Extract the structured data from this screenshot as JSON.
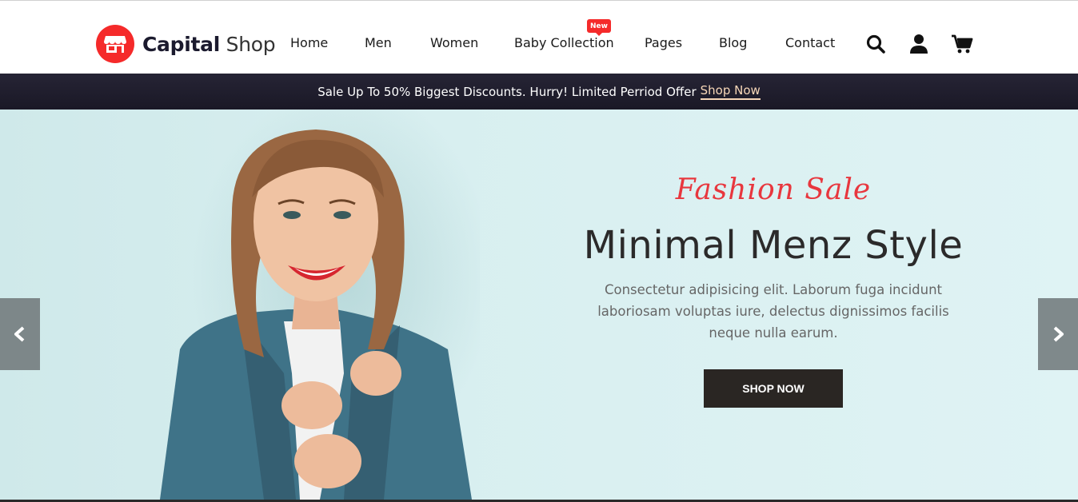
{
  "brand": {
    "name_bold": "Capital",
    "name_light": "Shop"
  },
  "nav": {
    "items": [
      {
        "label": "Home"
      },
      {
        "label": "Men"
      },
      {
        "label": "Women"
      },
      {
        "label": "Baby Collection",
        "badge": "New"
      },
      {
        "label": "Pages"
      },
      {
        "label": "Blog"
      },
      {
        "label": "Contact"
      }
    ]
  },
  "header_icons": [
    "search-icon",
    "user-icon",
    "cart-icon"
  ],
  "promo": {
    "text": "Sale Up To 50% Biggest Discounts. Hurry! Limited Perriod Offer",
    "link": "Shop Now"
  },
  "hero": {
    "script_title": "Fashion Sale",
    "headline": "Minimal Menz Style",
    "description": "Consectetur adipisicing elit. Laborum fuga incidunt laboriosam voluptas iure, delectus dignissimos facilis neque nulla earum.",
    "button": "SHOP NOW"
  },
  "colors": {
    "accent": "#f52a2a",
    "dark": "#1b1a2e",
    "promo_bg": "#1f1d2c",
    "promo_link": "#f7d7b8",
    "hero_bg": "#d8eff0",
    "script": "#e8373e",
    "button_bg": "#2a2623"
  }
}
